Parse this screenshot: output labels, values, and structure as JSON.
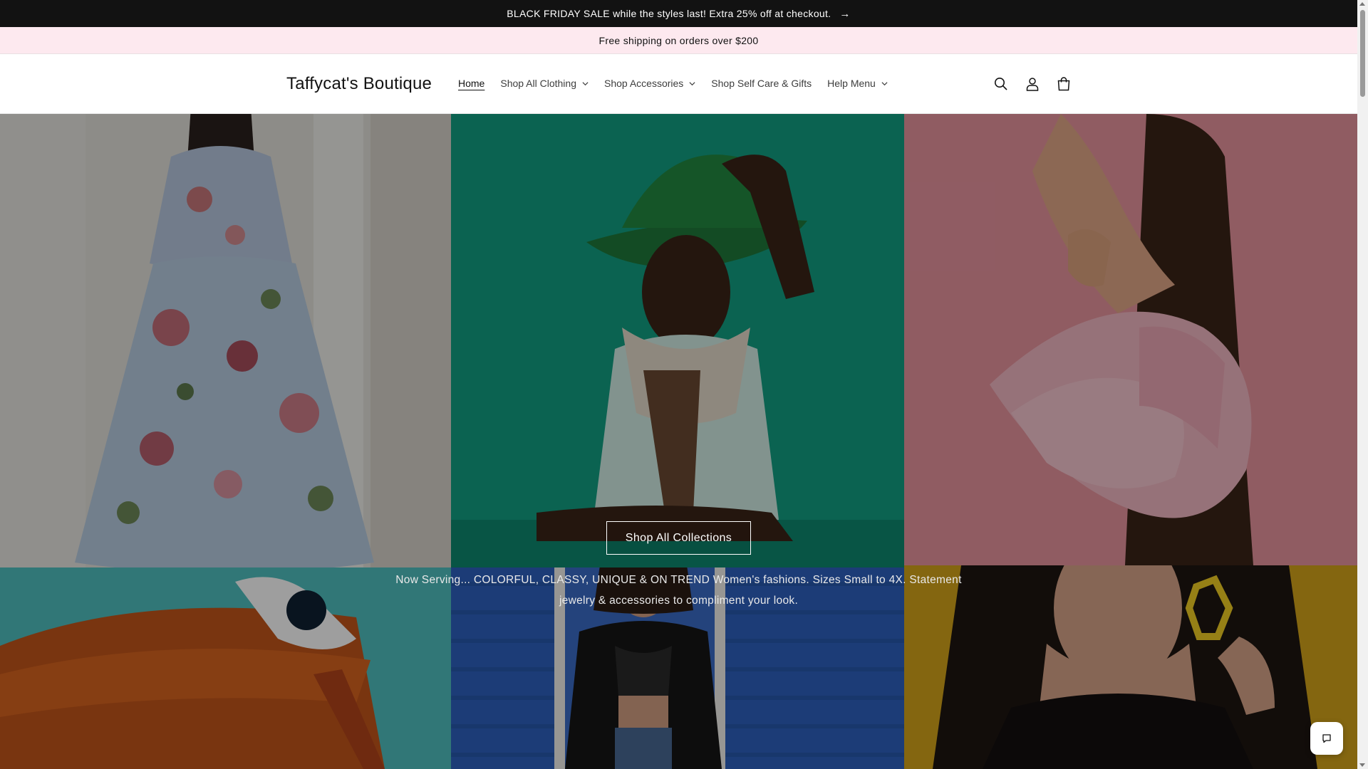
{
  "announcement_bar": {
    "text": "BLACK FRIDAY SALE while the styles last! Extra 25% off at checkout.",
    "arrow": "→"
  },
  "shipping_bar": {
    "text": "Free shipping on orders over $200"
  },
  "header": {
    "logo": "Taffycat's Boutique",
    "nav": [
      {
        "label": "Home"
      },
      {
        "label": "Shop All Clothing"
      },
      {
        "label": "Shop Accessories"
      },
      {
        "label": "Shop Self Care & Gifts"
      },
      {
        "label": "Help Menu"
      }
    ],
    "icons": [
      "search-icon",
      "account-icon",
      "cart-icon"
    ]
  },
  "hero": {
    "button_label": "Shop All Collections",
    "description": "Now Serving... COLORFUL, CLASSY, UNIQUE & ON TREND Women's fashions. Sizes Small to 4X. Statement jewelry & accessories to compliment your look."
  },
  "colors": {
    "announcement_bg": "#121212",
    "shipping_bg": "#fde9ef",
    "text": "#121212"
  }
}
